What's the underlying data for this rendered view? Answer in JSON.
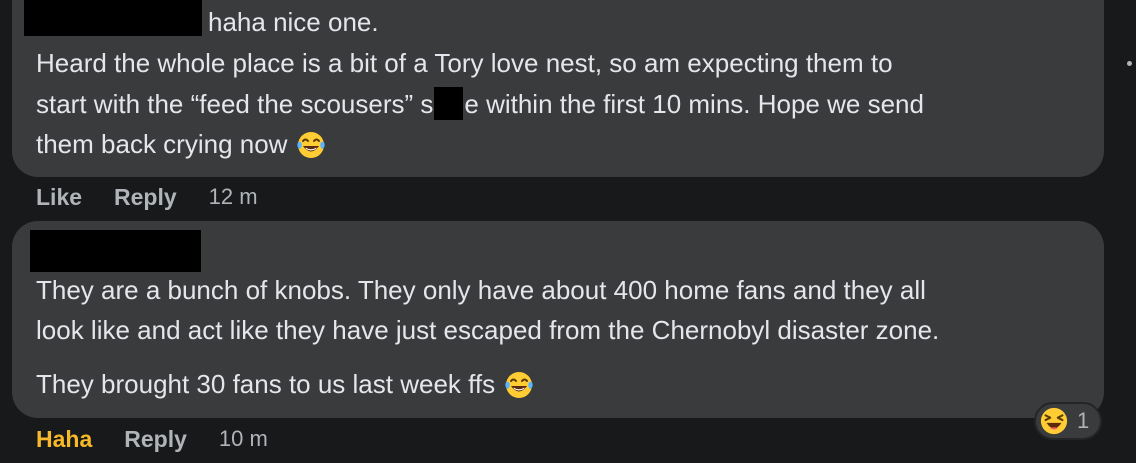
{
  "comments": [
    {
      "reply_prefix": "haha nice one.",
      "lines": [
        "Heard the whole place is a bit of a Tory love nest, so am expecting them to",
        "start with the “feed the scousers” s",
        "e within the first 10 mins. Hope we send",
        "them back crying now"
      ],
      "emoji": "tears-of-joy-emoji",
      "actions": {
        "like": "Like",
        "reply": "Reply",
        "time": "12 m"
      }
    },
    {
      "lines": [
        "They are a bunch of knobs. They only have about 400 home fans and they all",
        "look like and act like they have just escaped from the Chernobyl disaster zone.",
        "They brought 30 fans to us last week ffs"
      ],
      "emoji": "tears-of-joy-emoji",
      "actions": {
        "reaction": "Haha",
        "reply": "Reply",
        "time": "10 m"
      },
      "reaction_summary": {
        "icon": "laughing-emoji",
        "count": "1"
      }
    }
  ],
  "colors": {
    "background": "#18191a",
    "bubble": "#3a3b3c",
    "text": "#e4e6eb",
    "secondary_text": "#b0b3b8",
    "haha_active": "#f7b928",
    "redaction": "#000000"
  },
  "icons": {
    "more_options": "more-options-icon"
  }
}
